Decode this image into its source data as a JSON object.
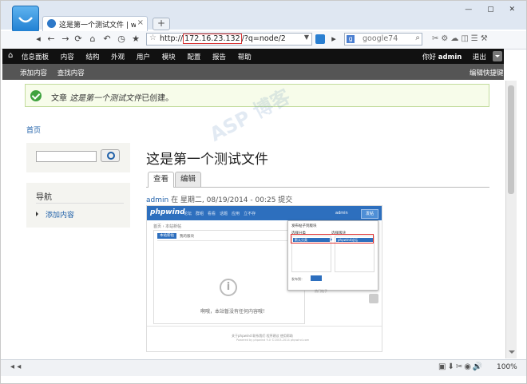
{
  "browser": {
    "tab_title": "这是第一个测试文件 | www.te...",
    "tab_close": "×",
    "new_tab": "+",
    "url_scheme": "http://",
    "url_host": "172.16.23.132",
    "url_path": "/?q=node/2",
    "search_text": "google74",
    "search_engine_glyph": "g",
    "window_controls": "— ▢ ✕",
    "zoom": "100%"
  },
  "admin_menu": {
    "home_glyph": "⌂",
    "items": [
      "信息面板",
      "内容",
      "结构",
      "外观",
      "用户",
      "模块",
      "配置",
      "报告",
      "帮助"
    ],
    "greeting_prefix": "你好",
    "username": "admin",
    "logout": "退出"
  },
  "shortcuts": {
    "items": [
      "添加内容",
      "查找内容"
    ],
    "edit": "编辑快捷键"
  },
  "status_message": {
    "prefix": "文章",
    "title": "这是第一个测试文件",
    "suffix": "已创建。"
  },
  "breadcrumb": "首页",
  "sidebar": {
    "nav_title": "导航",
    "nav_item": "添加内容"
  },
  "node": {
    "title": "这是第一个测试文件",
    "tabs": [
      "查看",
      "编辑"
    ],
    "author": "admin",
    "submitted": " 在 星期二, 08/19/2014 - 00:25 提交"
  },
  "embedded": {
    "logo": "phpwind",
    "nav": [
      "论坛",
      "群组",
      "看看",
      "话题",
      "应用",
      "立不存"
    ],
    "admin": "admin",
    "btn": "发帖",
    "breadcrumb": "首页 › 本站新帖",
    "tab_active": "本站新帖",
    "tab_other": "我的版块",
    "empty_msg": "啊哦，本站暂没有任何内容哦！",
    "dialog_title": "发布帖子到版块",
    "dialog_head": [
      "选择分类",
      "选择版块"
    ],
    "sel_a": "默认分类",
    "sel_b": "phpwind论坛",
    "dialog_foot": "发布到：",
    "right_col": "热门帖子",
    "footer": "关于phpwind  联系我们  程序建议  使用帮助",
    "footer2": "Powered by phpwind 9.0 ©2003-2014 phpwind.com"
  },
  "watermark": "ASP 博客",
  "colors": {
    "admin_bar": "#111111",
    "shortcut_bar": "#555555",
    "status_bg": "#f7fcea",
    "link": "#1e5fa8",
    "url_highlight": "#d93636"
  }
}
